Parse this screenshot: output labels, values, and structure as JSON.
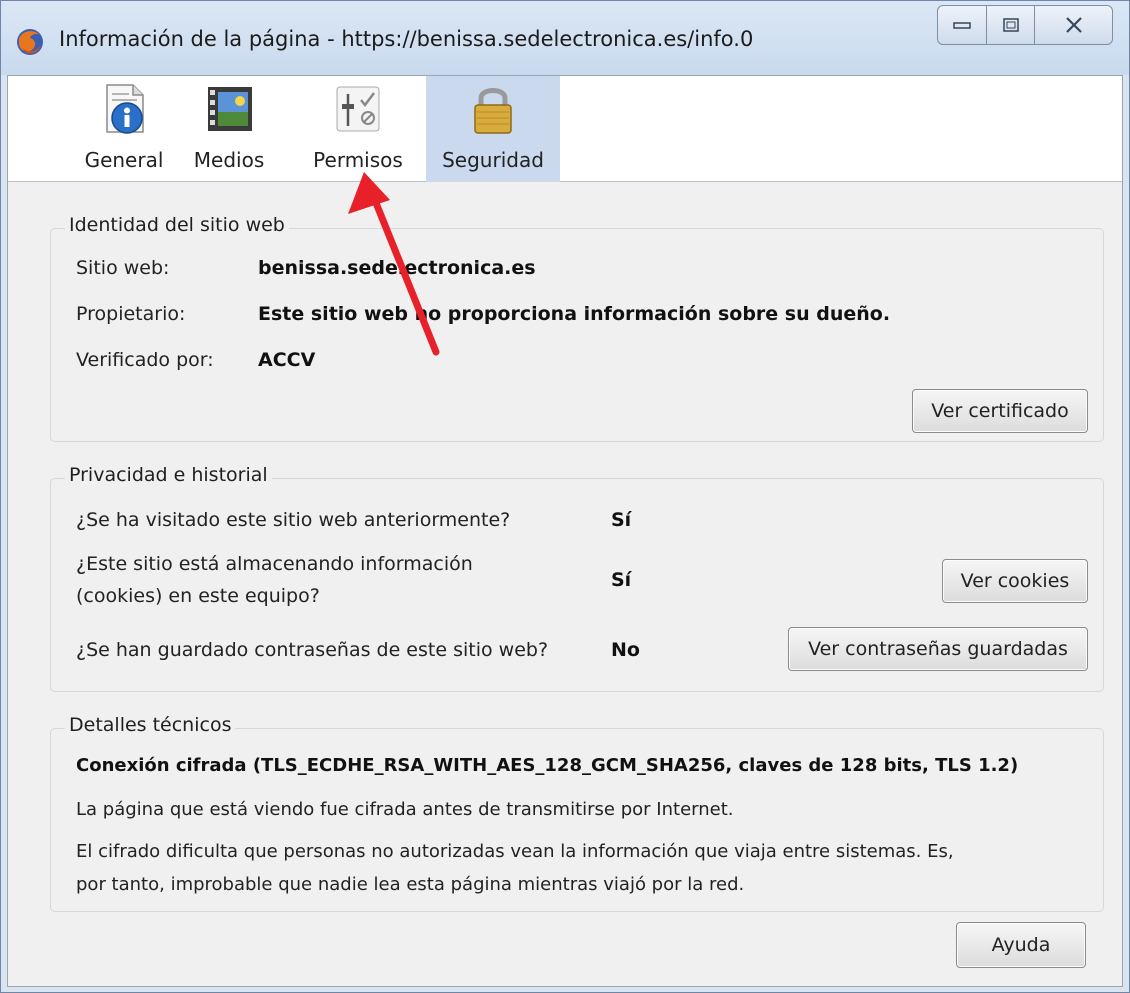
{
  "window": {
    "title": "Información de la página - https://benissa.sedelectronica.es/info.0"
  },
  "tabs": [
    {
      "label": "General",
      "icon": "info-page-icon"
    },
    {
      "label": "Medios",
      "icon": "media-film-icon"
    },
    {
      "label": "Permisos",
      "icon": "permissions-sliders-icon"
    },
    {
      "label": "Seguridad",
      "icon": "padlock-icon",
      "active": true
    }
  ],
  "identity": {
    "title": "Identidad del sitio web",
    "website_label": "Sitio web:",
    "website_value": "benissa.sedelectronica.es",
    "owner_label": "Propietario:",
    "owner_value": "Este sitio web no proporciona información sobre su dueño.",
    "verified_label": "Verificado por:",
    "verified_value": "ACCV",
    "view_cert_button": "Ver certificado"
  },
  "privacy": {
    "title": "Privacidad e historial",
    "q1": "¿Se ha visitado este sitio web anteriormente?",
    "a1": "Sí",
    "q2_line1": "¿Este sitio está almacenando información",
    "q2_line2": "(cookies) en este equipo?",
    "a2": "Sí",
    "cookies_button": "Ver cookies",
    "q3": "¿Se han guardado contraseñas de este sitio web?",
    "a3": "No",
    "passwords_button": "Ver contraseñas guardadas"
  },
  "technical": {
    "title": "Detalles técnicos",
    "connection": "Conexión cifrada (TLS_ECDHE_RSA_WITH_AES_128_GCM_SHA256, claves de 128 bits, TLS 1.2)",
    "line1": "La página que está viendo fue cifrada antes de transmitirse por Internet.",
    "line2": "El cifrado dificulta que personas no autorizadas vean la información que viaja entre sistemas. Es,",
    "line3": "por tanto, improbable que nadie lea esta página mientras viajó por la red."
  },
  "help_button": "Ayuda",
  "colors": {
    "active_tab": "#cad9ee",
    "annotation_arrow": "#e8202a"
  }
}
